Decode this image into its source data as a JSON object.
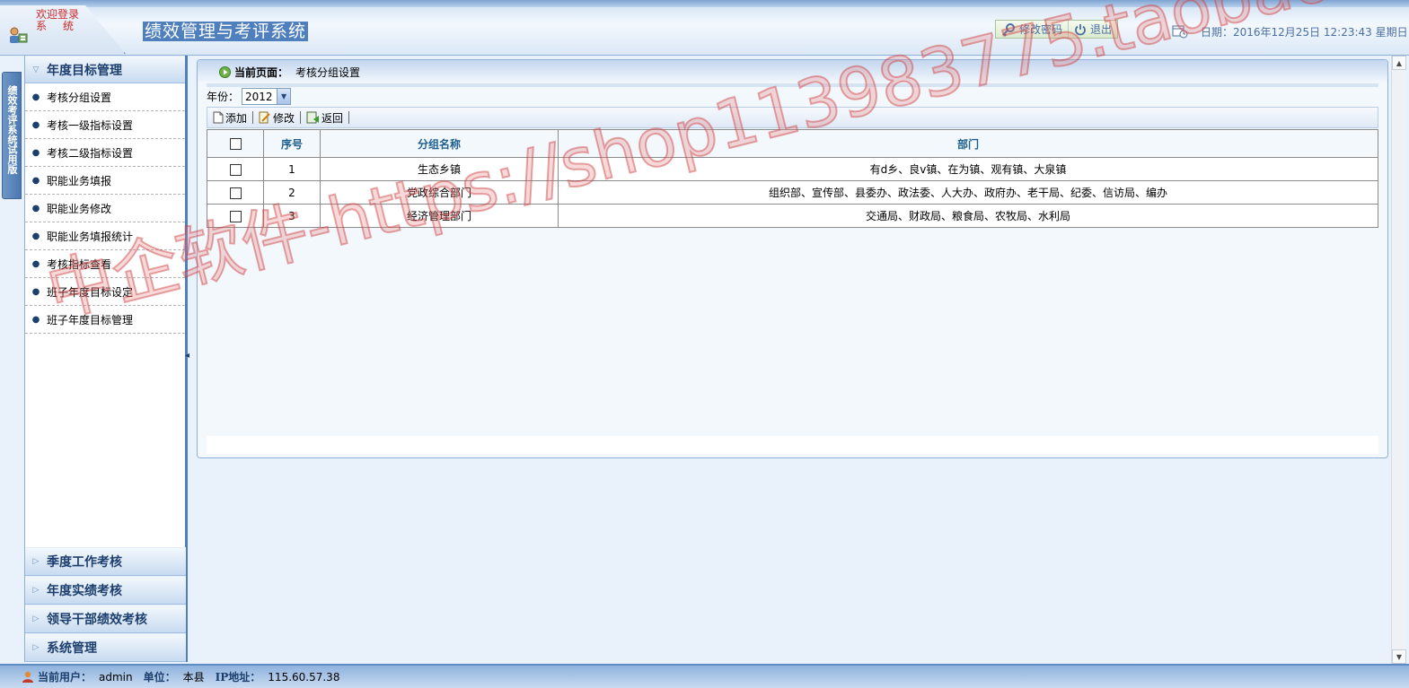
{
  "header": {
    "welcome_line1": "欢迎登录",
    "welcome_line2": "系统",
    "system_title": "绩效管理与考评系统",
    "change_password": "修改密码",
    "logout": "退出",
    "date_text": "日期：2016年12月25日  12:23:43 星期日"
  },
  "side_tab": {
    "label": "绩效考评系统试用版"
  },
  "sidebar": {
    "active_menu": "年度目标管理",
    "items": [
      {
        "label": "考核分组设置"
      },
      {
        "label": "考核一级指标设置"
      },
      {
        "label": "考核二级指标设置"
      },
      {
        "label": "职能业务填报"
      },
      {
        "label": "职能业务修改"
      },
      {
        "label": "职能业务填报统计"
      },
      {
        "label": "考核指标查看"
      },
      {
        "label": "班子年度目标设定"
      },
      {
        "label": "班子年度目标管理"
      }
    ],
    "other_menus": [
      {
        "label": "季度工作考核"
      },
      {
        "label": "年度实绩考核"
      },
      {
        "label": "领导干部绩效考核"
      },
      {
        "label": "系统管理"
      }
    ]
  },
  "main": {
    "breadcrumb_label": "当前页面：",
    "breadcrumb_value": "考核分组设置",
    "year_label": "年份：",
    "year_value": "2012",
    "toolbar": {
      "add": "添加",
      "edit": "修改",
      "back": "返回"
    },
    "table": {
      "headers": {
        "seq": "序号",
        "name": "分组名称",
        "dept": "部门"
      },
      "rows": [
        {
          "seq": "1",
          "name": "生态乡镇",
          "dept": "有d乡、良v镇、在为镇、观有镇、大泉镇"
        },
        {
          "seq": "2",
          "name": "党政综合部门",
          "dept": "组织部、宣传部、县委办、政法委、人大办、政府办、老干局、纪委、信访局、编办"
        },
        {
          "seq": "3",
          "name": "经济管理部门",
          "dept": "交通局、财政局、粮食局、农牧局、水利局"
        }
      ]
    }
  },
  "status": {
    "user_label": "当前用户：",
    "user_value": "admin",
    "unit_label": "单位：",
    "unit_value": "本县",
    "ip_label": "IP地址：",
    "ip_value": "115.60.57.38"
  },
  "watermark": "中企软件-https://shop113983775.taobao.com",
  "colors": {
    "accent": "#4f80bd",
    "header_text": "#1c3f6e",
    "table_header_text": "#1c5f8f"
  }
}
